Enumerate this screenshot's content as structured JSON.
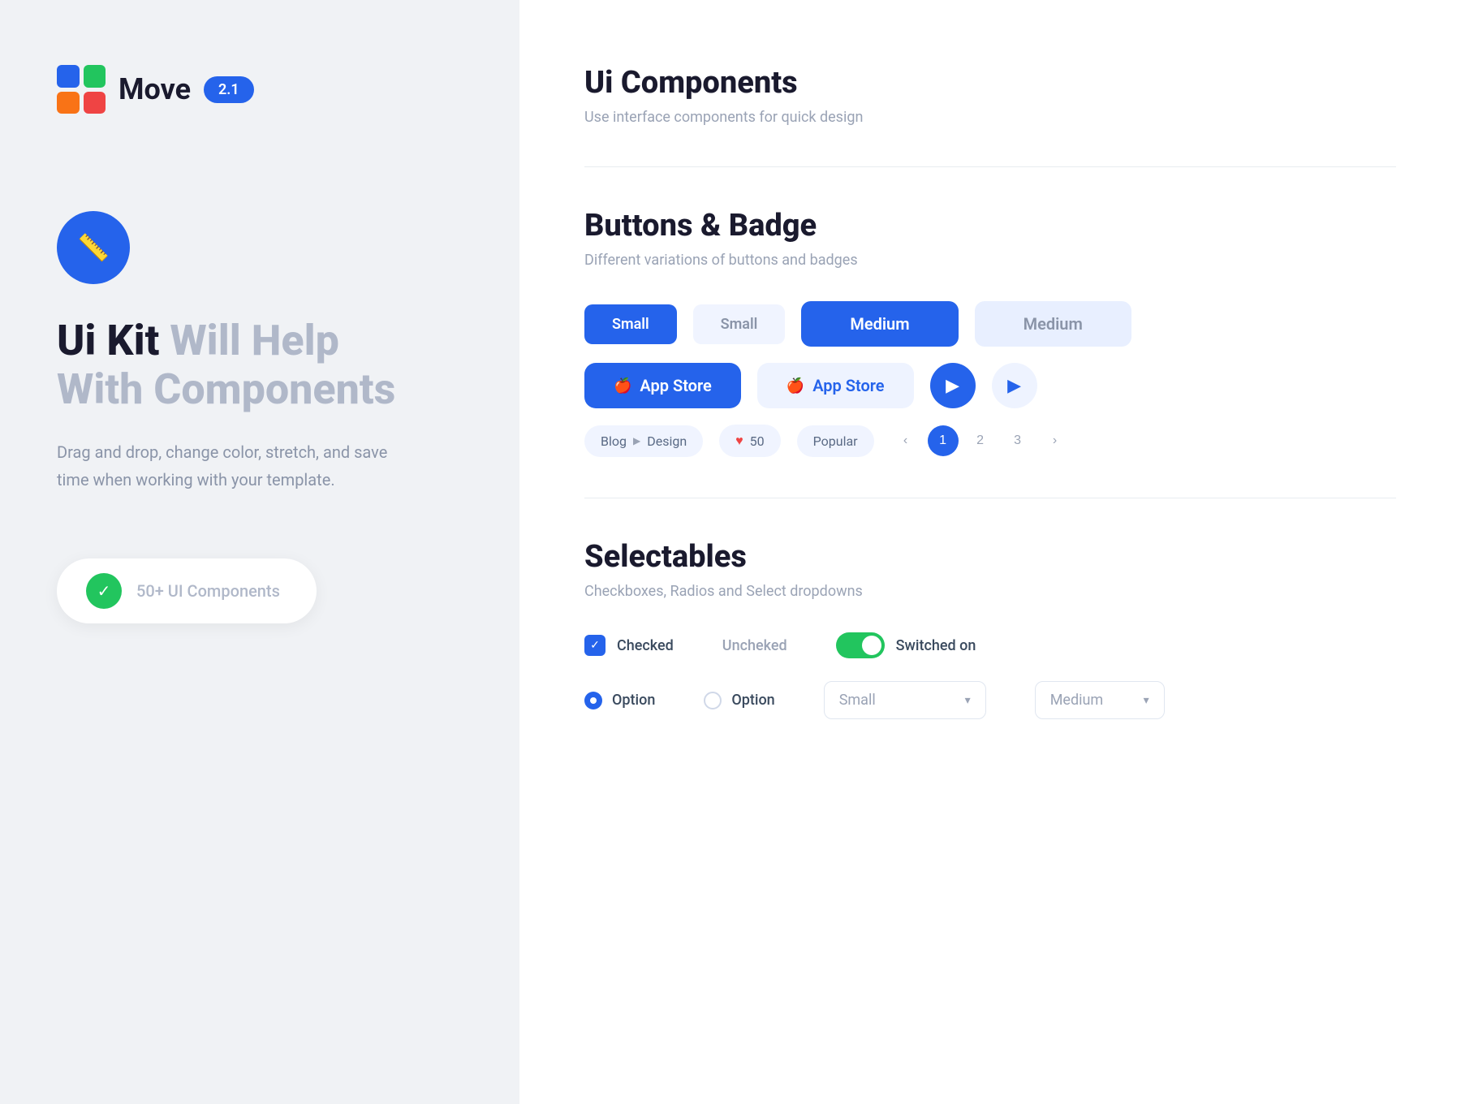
{
  "left": {
    "logo_text": "Move",
    "version": "2.1",
    "hero_title_dark": "Ui Kit ",
    "hero_title_light1": "Will Help",
    "hero_title_light2": "With Components",
    "hero_desc": "Drag and drop, change color, stretch, and save time when working with your template.",
    "badge_text": "50+ UI Components"
  },
  "right": {
    "main_title": "Ui Components",
    "main_sub": "Use interface components for quick design",
    "buttons_title": "Buttons & Badge",
    "buttons_sub": "Different variations of buttons and badges",
    "btn_small_blue": "Small",
    "btn_small_outline": "Small",
    "btn_medium_blue": "Medium",
    "btn_medium_outline": "Medium",
    "btn_appstore_blue": "App Store",
    "btn_appstore_light": "App Store",
    "breadcrumb_start": "Blog",
    "breadcrumb_end": "Design",
    "badge_heart_count": "50",
    "badge_popular": "Popular",
    "pagination_prev": "‹",
    "pagination_next": "›",
    "pagination_1": "1",
    "pagination_2": "2",
    "pagination_3": "3",
    "selectables_title": "Selectables",
    "selectables_sub": "Checkboxes, Radios and Select dropdowns",
    "checked_label": "Checked",
    "unchecked_label": "Uncheked",
    "toggle_label": "Switched on",
    "option1_label": "Option",
    "option2_label": "Option",
    "select_small": "Small",
    "select_medium": "Medium"
  }
}
